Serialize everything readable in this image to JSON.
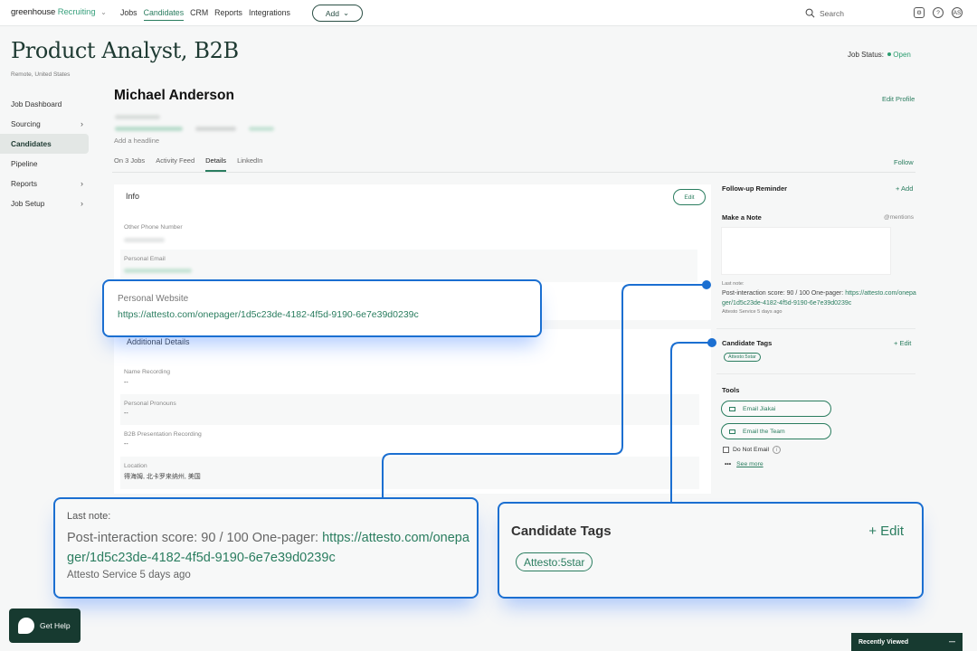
{
  "topnav": {
    "brand": "greenhouse",
    "brand_product": "Recruiting",
    "links": [
      "Jobs",
      "Candidates",
      "CRM",
      "Reports",
      "Integrations"
    ],
    "active_link": "Candidates",
    "add_label": "Add",
    "search_placeholder": "Search",
    "avatar_initials": "AS"
  },
  "job": {
    "title": "Product Analyst, B2B",
    "location": "Remote, United States",
    "status_label": "Job Status:",
    "status_value": "Open"
  },
  "sidebar": {
    "items": [
      {
        "label": "Job Dashboard",
        "has_chevron": false
      },
      {
        "label": "Sourcing",
        "has_chevron": true
      },
      {
        "label": "Candidates",
        "has_chevron": false,
        "active": true
      },
      {
        "label": "Pipeline",
        "has_chevron": false
      },
      {
        "label": "Reports",
        "has_chevron": true
      },
      {
        "label": "Job Setup",
        "has_chevron": true
      }
    ]
  },
  "candidate": {
    "name": "Michael  Anderson",
    "headline_placeholder": "Add a headline",
    "edit_profile": "Edit Profile",
    "follow": "Follow",
    "tabs": [
      "On 3 Jobs",
      "Activity Feed",
      "Details",
      "LinkedIn"
    ],
    "active_tab": "Details"
  },
  "info": {
    "title": "Info",
    "edit": "Edit",
    "fields": [
      {
        "label": "Other Phone Number",
        "value": ""
      },
      {
        "label": "Personal Email",
        "value": ""
      },
      {
        "label": "Personal Website",
        "value": "https://attesto.com/onepager/1d5c23de-4182-4f5d-9190-6e7e39d0239c"
      }
    ]
  },
  "additional": {
    "title": "Additional Details",
    "fields": [
      {
        "label": "Name Recording",
        "value": "--"
      },
      {
        "label": "Personal Pronouns",
        "value": "--"
      },
      {
        "label": "B2B Presentation Recording",
        "value": "--"
      },
      {
        "label": "Location",
        "value": "得海姆, 北卡罗来纳州, 美国"
      }
    ]
  },
  "right": {
    "followup_title": "Follow-up Reminder",
    "followup_add": "+ Add",
    "note_title": "Make a Note",
    "note_mentions": "@mentions",
    "last_note_label": "Last note:",
    "last_note_text": "Post-interaction score: 90 / 100 One-pager: ",
    "last_note_url": "https://attesto.com/onepager/1d5c23de-4182-4f5d-9190-6e7e39d0239c",
    "last_note_by": "Attesto Service 5 days ago",
    "tags_title": "Candidate Tags",
    "tags_edit": "+ Edit",
    "tags": [
      "Attesto:5star"
    ],
    "tools_title": "Tools",
    "tools": [
      "Email Jiakai",
      "Email the Team"
    ],
    "do_not_email": "Do Not Email",
    "see_more": "See more"
  },
  "callouts": {
    "website_label": "Personal Website",
    "website_url": "https://attesto.com/onepager/1d5c23de-4182-4f5d-9190-6e7e39d0239c",
    "note_label": "Last note:",
    "note_text": "Post-interaction score: 90 / 100 One-pager: ",
    "note_url": "https://attesto.com/onepager/1d5c23de-4182-4f5d-9190-6e7e39d0239c",
    "note_by": "Attesto Service 5 days ago",
    "tags_title": "Candidate Tags",
    "tags_edit": "+ Edit",
    "tag": "Attesto:5star"
  },
  "widgets": {
    "get_help": "Get Help",
    "recently_viewed": "Recently Viewed"
  },
  "colors": {
    "accent_green": "#2a7d5f",
    "brand_dark": "#173a30",
    "callout_blue": "#1b6fd1"
  }
}
